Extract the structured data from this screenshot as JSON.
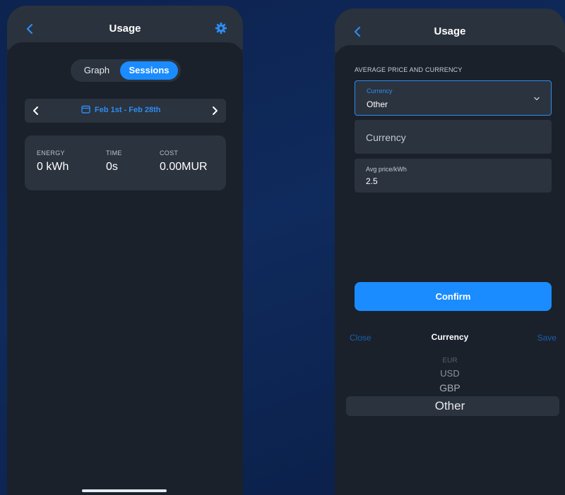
{
  "left_screen": {
    "title": "Usage",
    "segments": {
      "graph": "Graph",
      "sessions": "Sessions",
      "selected": "Sessions"
    },
    "date_range": "Feb 1st - Feb 28th",
    "stats": {
      "energy_label": "ENERGY",
      "energy_value": "0 kWh",
      "time_label": "TIME",
      "time_value": "0s",
      "cost_label": "COST",
      "cost_value": "0.00MUR"
    }
  },
  "right_screen": {
    "title": "Usage",
    "section_title": "AVERAGE PRICE AND CURRENCY",
    "currency_select": {
      "label": "Currency",
      "value": "Other"
    },
    "currency_input": {
      "placeholder": "Currency"
    },
    "avg_price": {
      "label": "Avg price/kWh",
      "value": "2.5"
    },
    "confirm_label": "Confirm",
    "picker": {
      "close_label": "Close",
      "title": "Currency",
      "save_label": "Save",
      "options": [
        "EUR",
        "USD",
        "GBP",
        "Other"
      ],
      "selected": "Other"
    }
  },
  "colors": {
    "accent": "#1a8cff",
    "background": "#0f2a5c",
    "surface": "#2b333e",
    "screen": "#1a212b"
  },
  "icons": [
    "back-icon",
    "gear-icon",
    "calendar-icon",
    "chevron-left-icon",
    "chevron-right-icon",
    "chevron-down-icon"
  ]
}
